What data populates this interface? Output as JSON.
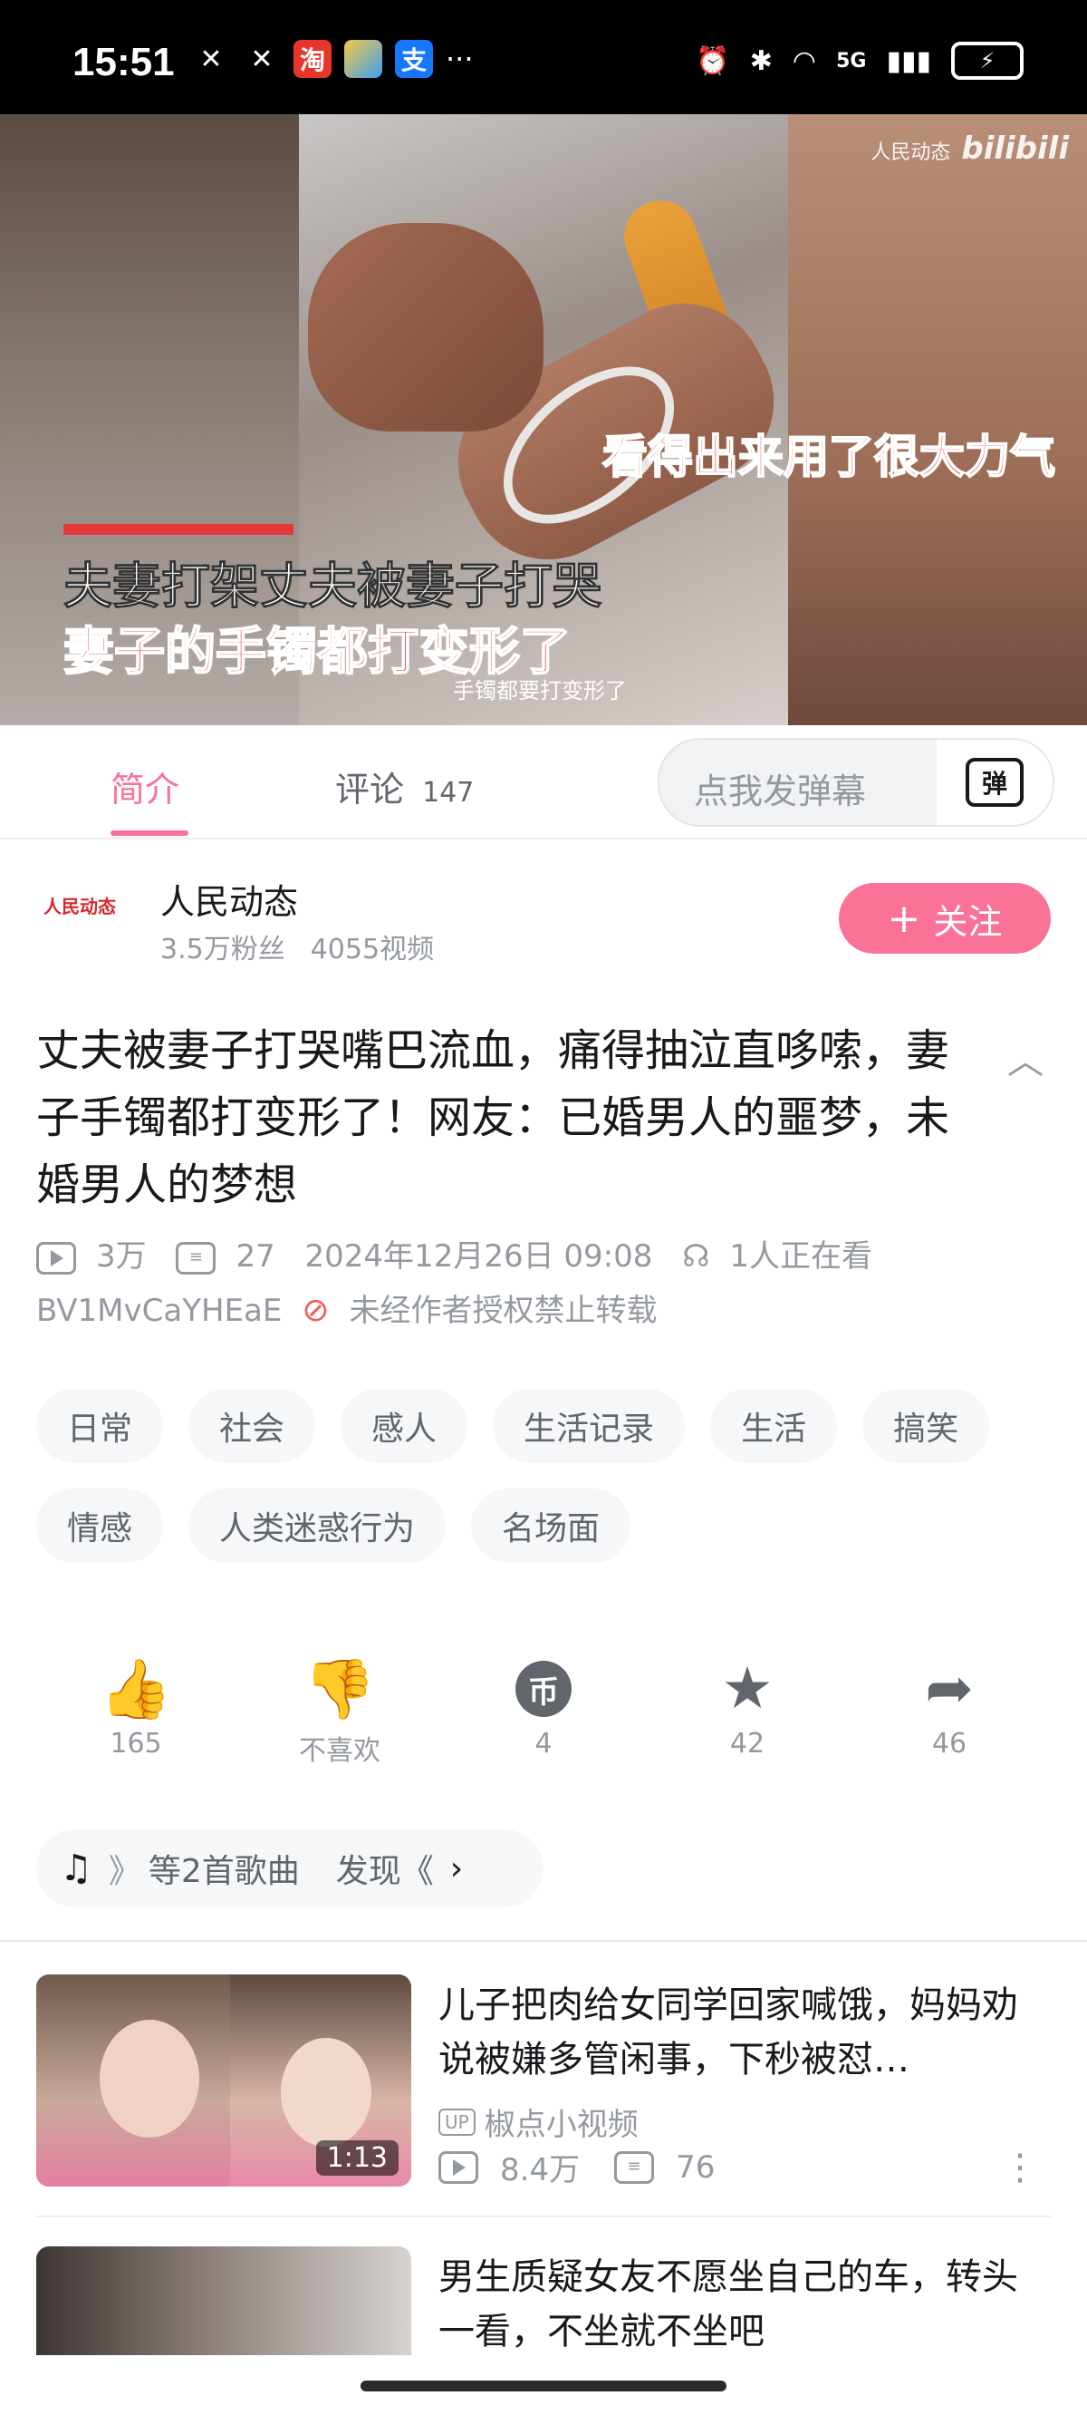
{
  "status_bar": {
    "time": "15:51",
    "left_icons": [
      "missed-call-icon",
      "missed-call-icon",
      "taobao-icon",
      "app-icon",
      "alipay-icon"
    ],
    "taobao_char": "淘",
    "alipay_char": "支",
    "more": "···",
    "network": "5G"
  },
  "video": {
    "watermark_channel": "人民动态",
    "watermark_brand": "bilibili",
    "caption_top": "看得出来用了很大力气",
    "caption_white": "夫妻打架丈夫被妻子打哭",
    "caption_red": "妻子的手镯都打变形了",
    "subtitle": "手镯都要打变形了"
  },
  "tabs": {
    "intro": "简介",
    "comments": "评论",
    "comment_count": "147",
    "danmaku_placeholder": "点我发弹幕",
    "danmaku_btn": "弹"
  },
  "uploader": {
    "avatar_text": "人民动态",
    "name": "人民动态",
    "fans": "3.5万粉丝",
    "videos": "4055视频",
    "follow_label": "关注",
    "follow_plus": "+"
  },
  "video_info": {
    "title": "丈夫被妻子打哭嘴巴流血，痛得抽泣直哆嗦，妻子手镯都打变形了！网友：已婚男人的噩梦，未婚男人的梦想",
    "views": "3万",
    "danmaku_count": "27",
    "date": "2024年12月26日 09:08",
    "watching": "1人正在看",
    "bvid": "BV1MvCaYHEaE",
    "copyright": "未经作者授权禁止转载"
  },
  "tags": [
    "日常",
    "社会",
    "感人",
    "生活记录",
    "生活",
    "搞笑",
    "情感",
    "人类迷惑行为",
    "名场面"
  ],
  "actions": {
    "like_count": "165",
    "dislike_label": "不喜欢",
    "coin_count": "4",
    "fav_count": "42",
    "share_count": "46"
  },
  "music": {
    "text": "等2首歌曲",
    "discover": "发现《"
  },
  "recommendations": [
    {
      "title": "儿子把肉给女同学回家喊饿，妈妈劝说被嫌多管闲事，下秒被怼…",
      "duration": "1:13",
      "uploader": "椒点小视频",
      "up_badge": "UP",
      "views": "8.4万",
      "danmaku": "76"
    },
    {
      "title": "男生质疑女友不愿坐自己的车，转头一看，不坐就不坐吧"
    }
  ]
}
